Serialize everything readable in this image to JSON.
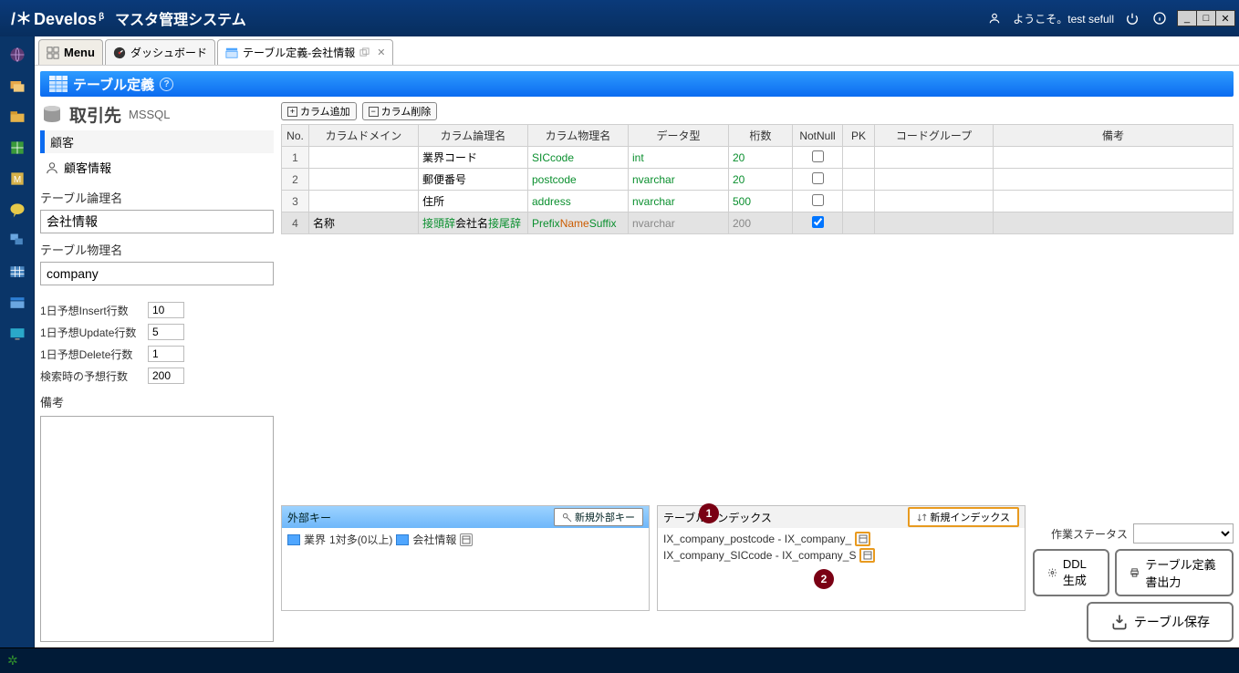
{
  "titlebar": {
    "app": "Develos",
    "beta": "β",
    "subtitle": "マスタ管理システム",
    "welcome": "ようこそ。test sefull"
  },
  "tabs": {
    "menu": "Menu",
    "dashboard": "ダッシュボード",
    "active": "テーブル定義-会社情報"
  },
  "page": {
    "header_icon": "table-icon",
    "title": "テーブル定義"
  },
  "left": {
    "schema_name": "取引先",
    "db_type": "MSSQL",
    "category": "顧客",
    "owner": "顧客情報",
    "logical_label": "テーブル論理名",
    "logical_value": "会社情報",
    "physical_label": "テーブル物理名",
    "physical_value": "company",
    "insert_label": "1日予想Insert行数",
    "insert_value": "10",
    "update_label": "1日予想Update行数",
    "update_value": "5",
    "delete_label": "1日予想Delete行数",
    "delete_value": "1",
    "search_label": "検索時の予想行数",
    "search_value": "200",
    "remarks_label": "備考"
  },
  "toolbar": {
    "add_col": "カラム追加",
    "del_col": "カラム削除"
  },
  "columns": {
    "headers": [
      "No.",
      "カラムドメイン",
      "カラム論理名",
      "カラム物理名",
      "データ型",
      "桁数",
      "NotNull",
      "PK",
      "コードグループ",
      "備考"
    ],
    "rows": [
      {
        "no": "1",
        "domain": "",
        "logical": "業界コード",
        "physical": "SICcode",
        "dtype": "int",
        "digits": "20",
        "notnull": false,
        "pk": ""
      },
      {
        "no": "2",
        "domain": "",
        "logical": "郵便番号",
        "physical": "postcode",
        "dtype": "nvarchar",
        "digits": "20",
        "notnull": false,
        "pk": ""
      },
      {
        "no": "3",
        "domain": "",
        "logical": "住所",
        "physical": "address",
        "dtype": "nvarchar",
        "digits": "500",
        "notnull": false,
        "pk": ""
      },
      {
        "no": "4",
        "domain": "名称",
        "logical_prefix": "接頭辞",
        "logical_main": "会社名",
        "logical_suffix": "接尾辞",
        "physical_prefix": "Prefix",
        "physical_main": "Name",
        "physical_suffix": "Suffix",
        "dtype": "nvarchar",
        "digits": "200",
        "notnull": true,
        "pk": ""
      }
    ]
  },
  "fk_panel": {
    "title": "外部キー",
    "new_btn": "新規外部キー",
    "row_left": "業界",
    "row_rel": "1対多(0以上)",
    "row_right": "会社情報"
  },
  "idx_panel": {
    "title": "テーブルインデックス",
    "new_btn": "新規インデックス",
    "rows": [
      "IX_company_postcode - IX_company_",
      "IX_company_SICcode - IX_company_S"
    ]
  },
  "actions": {
    "status_label": "作業ステータス",
    "ddl": "DDL生成",
    "def_output": "テーブル定義書出力",
    "save": "テーブル保存"
  },
  "badges": {
    "one": "1",
    "two": "2"
  }
}
